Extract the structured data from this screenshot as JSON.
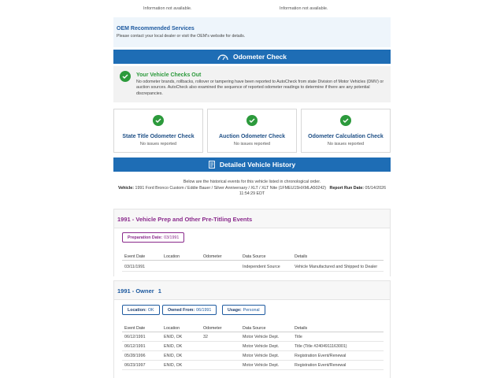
{
  "top_row": {
    "left": "Information not available.",
    "right": "Information not available."
  },
  "oem": {
    "title": "OEM Recommended Services",
    "text": "Please contact your local dealer or visit the OEM's website for details."
  },
  "odometer_bar": {
    "label": "Odometer Check",
    "icon": "odometer-icon"
  },
  "checks_out": {
    "title": "Your Vehicle Checks Out",
    "text": "No odometer brands, rollbacks, rollover or tampering have been reported to AutoCheck from state Division of Motor Vehicles (DMV) or auction sources. AutoCheck also examined the sequence of reported odometer readings to determine if there are any potential discrepancies."
  },
  "cards": [
    {
      "title": "State Title Odometer Check",
      "status": "No issues reported"
    },
    {
      "title": "Auction Odometer Check",
      "status": "No issues reported"
    },
    {
      "title": "Odometer Calculation Check",
      "status": "No issues reported"
    }
  ],
  "history_bar": {
    "label": "Detailed Vehicle History",
    "icon": "document-icon"
  },
  "history_intro": {
    "line": "Below are the historical events for this vehicle listed in chronological order.",
    "vehicle_label": "Vehicle:",
    "vehicle_value": "1991 Ford Bronco Custom / Eddie Bauer / Silver Anniversary / XLT / XLT Nite (1FMEU15HXMLA50242)",
    "run_date_label": "Report Run Date:",
    "run_date_value": "05/14/2026",
    "run_time": "11:54:29 EDT"
  },
  "columns": [
    "Event Date",
    "Location",
    "Odometer",
    "Data Source",
    "Details"
  ],
  "section1": {
    "title": "1991 - Vehicle Prep and Other Pre-Titling Events",
    "prep_label": "Preparation Date:",
    "prep_value": "03/1991",
    "rows": [
      {
        "date": "03/11/1991",
        "location": "",
        "odometer": "",
        "source": "Independent Source",
        "details": "Vehicle Manufactured and Shipped to Dealer"
      }
    ]
  },
  "section2": {
    "title": "1991 - Owner",
    "owner_number": "1",
    "location_label": "Location:",
    "location_value": "OK",
    "owned_label": "Owned From:",
    "owned_value": "06/1991",
    "usage_label": "Usage:",
    "usage_value": "Personal",
    "rows": [
      {
        "date": "06/12/1991",
        "location": "ENID, OK",
        "odometer": "32",
        "source": "Motor Vehicle Dept.",
        "details": "Title"
      },
      {
        "date": "06/12/1991",
        "location": "ENID, OK",
        "odometer": "",
        "source": "Motor Vehicle Dept.",
        "details": "Title (Title #2404911163001)"
      },
      {
        "date": "05/28/1996",
        "location": "ENID, OK",
        "odometer": "",
        "source": "Motor Vehicle Dept.",
        "details": "Registration Event/Renewal"
      },
      {
        "date": "06/23/1997",
        "location": "ENID, OK",
        "odometer": "",
        "source": "Motor Vehicle Dept.",
        "details": "Registration Event/Renewal"
      }
    ]
  },
  "colors": {
    "bar_blue": "#1e6db5",
    "success_green": "#2c9a3c",
    "title_purple": "#8a2a8c",
    "title_blue": "#1e5aa0"
  }
}
